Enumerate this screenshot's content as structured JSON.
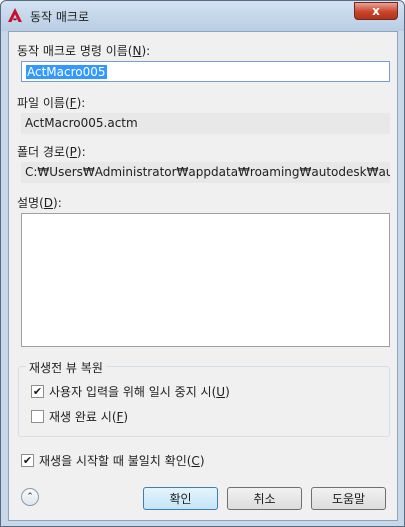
{
  "window": {
    "title": "동작 매크로",
    "close_label": "x"
  },
  "name_field": {
    "label_prefix": "동작 매크로 명령 이름(",
    "label_key": "N",
    "label_suffix": "):",
    "value": "ActMacro005"
  },
  "file_name": {
    "label_prefix": "파일 이름(",
    "label_key": "F",
    "label_suffix": "):",
    "value": "ActMacro005.actm"
  },
  "folder_path": {
    "label_prefix": "폴더 경로(",
    "label_key": "P",
    "label_suffix": "):",
    "value": "C:₩Users₩Administrator₩appdata₩roaming₩autodesk₩autocad lo"
  },
  "description": {
    "label_prefix": "설명(",
    "label_key": "D",
    "label_suffix": "):",
    "value": ""
  },
  "playback_group": {
    "title": "재생전 뷰 복원",
    "options": [
      {
        "label_prefix": "사용자 입력을 위해 일시 중지 시(",
        "label_key": "U",
        "label_suffix": ")",
        "checked": true
      },
      {
        "label_prefix": "재생 완료 시(",
        "label_key": "F",
        "label_suffix": ")",
        "checked": false
      }
    ]
  },
  "confirm_option": {
    "label_prefix": "재생을 시작할 때 불일치 확인(",
    "label_key": "C",
    "label_suffix": ")",
    "checked": true
  },
  "buttons": {
    "ok": "확인",
    "cancel": "취소",
    "help": "도움말"
  },
  "checkmark": "✔",
  "expand_glyph": "⌃"
}
